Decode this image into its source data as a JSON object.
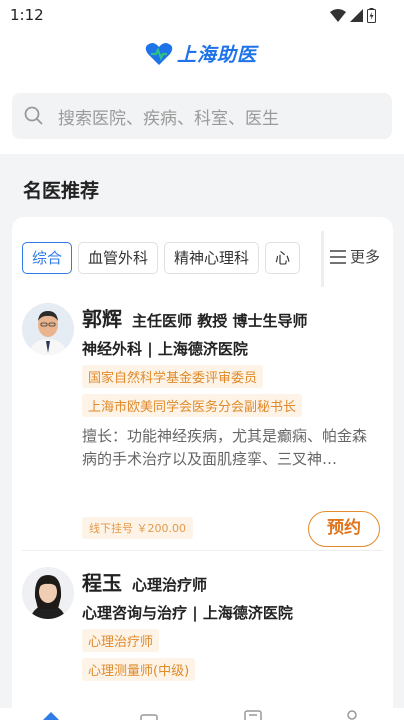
{
  "status_bar": {
    "time": "1:12"
  },
  "header": {
    "app_name": "上海助医"
  },
  "search": {
    "placeholder": "搜索医院、疾病、科室、医生"
  },
  "section": {
    "title": "名医推荐"
  },
  "tabs": [
    {
      "label": "综合",
      "active": true
    },
    {
      "label": "血管外科",
      "active": false
    },
    {
      "label": "精神心理科",
      "active": false
    },
    {
      "label": "心",
      "active": false
    }
  ],
  "more_label": "更多",
  "doctors": [
    {
      "name": "郭辉",
      "title": "主任医师 教授 博士生导师",
      "dept": "神经外科 | 上海德济医院",
      "tags": [
        "国家自然科学基金委评审委员",
        "上海市欧美同学会医务分会副秘书长"
      ],
      "skill": "擅长：功能神经疾病，尤其是癫痫、帕金森病的手术治疗以及面肌痉挛、三叉神…",
      "fee": "线下挂号 ￥200.00",
      "book_label": "预约"
    },
    {
      "name": "程玉",
      "title": "心理治疗师",
      "dept": "心理咨询与治疗 | 上海德济医院",
      "tags": [
        "心理治疗师",
        "心理测量师(中级)"
      ]
    }
  ],
  "colors": {
    "accent": "#2f7be8",
    "orange": "#e0751d",
    "tag_bg": "#fdf3e6"
  }
}
